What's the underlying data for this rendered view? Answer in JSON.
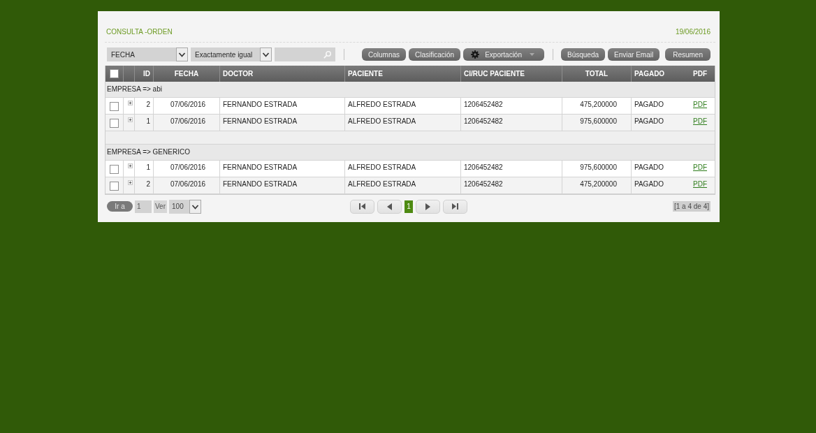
{
  "header": {
    "title": "CONSULTA -ORDEN",
    "date": "19/06/2016"
  },
  "toolbar": [
    {
      "kind": "select",
      "value": "FECHA"
    },
    {
      "kind": "select",
      "value": "Exactamente igual"
    },
    {
      "kind": "search"
    },
    {
      "kind": "divider"
    },
    {
      "kind": "button",
      "label": "Columnas"
    },
    {
      "kind": "button",
      "label": "Clasificación"
    },
    {
      "kind": "menu_button",
      "label": "Exportación"
    },
    {
      "kind": "divider"
    },
    {
      "kind": "button",
      "label": "Búsqueda"
    },
    {
      "kind": "button",
      "label": "Enviar Email"
    },
    {
      "kind": "button",
      "label": "Resumen"
    }
  ],
  "table": {
    "select_all": {
      "checked": false
    },
    "columns": [
      {
        "label": "ID",
        "kind": "text"
      },
      {
        "label": "FECHA",
        "kind": "text"
      },
      {
        "label": "DOCTOR",
        "kind": "text"
      },
      {
        "label": "PACIENTE",
        "kind": "text"
      },
      {
        "label": "CI/RUC PACIENTE",
        "kind": "text"
      },
      {
        "label": "TOTAL",
        "kind": "text"
      },
      {
        "label": "PAGADO",
        "kind": "text"
      },
      {
        "label": "PDF",
        "kind": "link"
      }
    ],
    "groups": [
      {
        "label": "EMPRESA => abi",
        "rows": [
          {
            "checked": false,
            "expanded": false,
            "cells": [
              "2",
              "07/06/2016",
              "FERNANDO ESTRADA",
              "ALFREDO ESTRADA",
              "1206452482",
              "475,200000",
              "PAGADO",
              "PDF"
            ]
          },
          {
            "checked": false,
            "expanded": false,
            "cells": [
              "1",
              "07/06/2016",
              "FERNANDO ESTRADA",
              "ALFREDO ESTRADA",
              "1206452482",
              "975,600000",
              "PAGADO",
              "PDF"
            ]
          }
        ]
      },
      {
        "label": "EMPRESA => GENERICO",
        "rows": [
          {
            "checked": false,
            "expanded": false,
            "cells": [
              "1",
              "07/06/2016",
              "FERNANDO ESTRADA",
              "ALFREDO ESTRADA",
              "1206452482",
              "975,600000",
              "PAGADO",
              "PDF"
            ]
          },
          {
            "checked": false,
            "expanded": false,
            "cells": [
              "2",
              "07/06/2016",
              "FERNANDO ESTRADA",
              "ALFREDO ESTRADA",
              "1206452482",
              "475,200000",
              "PAGADO",
              "PDF"
            ]
          }
        ]
      }
    ]
  },
  "pager": {
    "goto_button": "Ir a",
    "page_input": "1",
    "per_page_label": "Ver",
    "per_page": "100",
    "pages": [
      {
        "label": "1",
        "selected": true
      }
    ],
    "range": "[1 a 4 de 4]"
  }
}
